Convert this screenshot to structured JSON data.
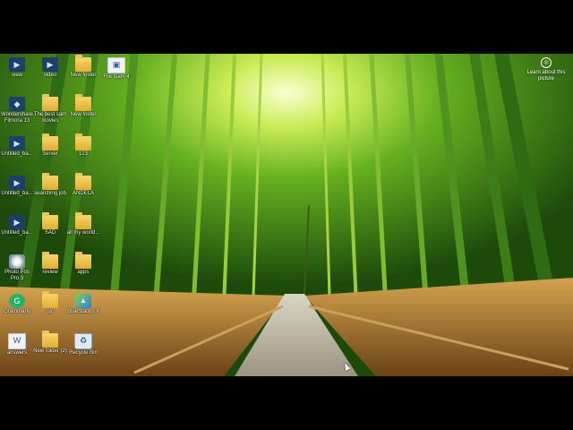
{
  "desktop": {
    "columns": [
      {
        "icons": [
          {
            "label": "view",
            "glyph": "app-icon"
          },
          {
            "label": "Wondershare Filmora 13",
            "glyph": "filmora-icon"
          },
          {
            "label": "Untitled_ba...",
            "glyph": "app-icon"
          },
          {
            "label": "Untitled_ba...",
            "glyph": "app-icon"
          },
          {
            "label": "Untitled_ba...",
            "glyph": "app-icon"
          },
          {
            "label": "Photo Pos Pro 3",
            "glyph": "photo-icon"
          },
          {
            "label": "Grammarly",
            "glyph": "grammarly-icon"
          },
          {
            "label": "answers",
            "glyph": "document-icon"
          }
        ]
      },
      {
        "icons": [
          {
            "label": "video",
            "glyph": "app-icon"
          },
          {
            "label": "The best sam movies",
            "glyph": "folder-icon"
          },
          {
            "label": "Server",
            "glyph": "folder-icon"
          },
          {
            "label": "searching job",
            "glyph": "folder-icon"
          },
          {
            "label": "SAD",
            "glyph": "folder-icon"
          },
          {
            "label": "review",
            "glyph": "folder-icon"
          },
          {
            "label": "pic",
            "glyph": "folder-icon"
          },
          {
            "label": "New folder (2)",
            "glyph": "folder-icon"
          }
        ]
      },
      {
        "icons": [
          {
            "label": "New folder",
            "glyph": "folder-icon"
          },
          {
            "label": "New folder",
            "glyph": "folder-icon"
          },
          {
            "label": "123",
            "glyph": "folder-icon"
          },
          {
            "label": "ANDELA",
            "glyph": "folder-icon"
          },
          {
            "label": "all my world...",
            "glyph": "folder-icon"
          },
          {
            "label": "apps",
            "glyph": "folder-icon"
          },
          {
            "label": "BlueStacks X",
            "glyph": "bluestacks-icon"
          },
          {
            "label": "Recycle Bin",
            "glyph": "recycle-bin-icon"
          }
        ]
      },
      {
        "icons": [
          {
            "label": "File Gam 4",
            "glyph": "image-file-icon"
          }
        ]
      }
    ]
  },
  "learn_about": {
    "label": "Learn about this picture",
    "glyph": "camera-icon"
  },
  "colors": {
    "letterbox": "#000000",
    "bamboo_green": "#4e9a1e",
    "path": "#b9b29b"
  }
}
